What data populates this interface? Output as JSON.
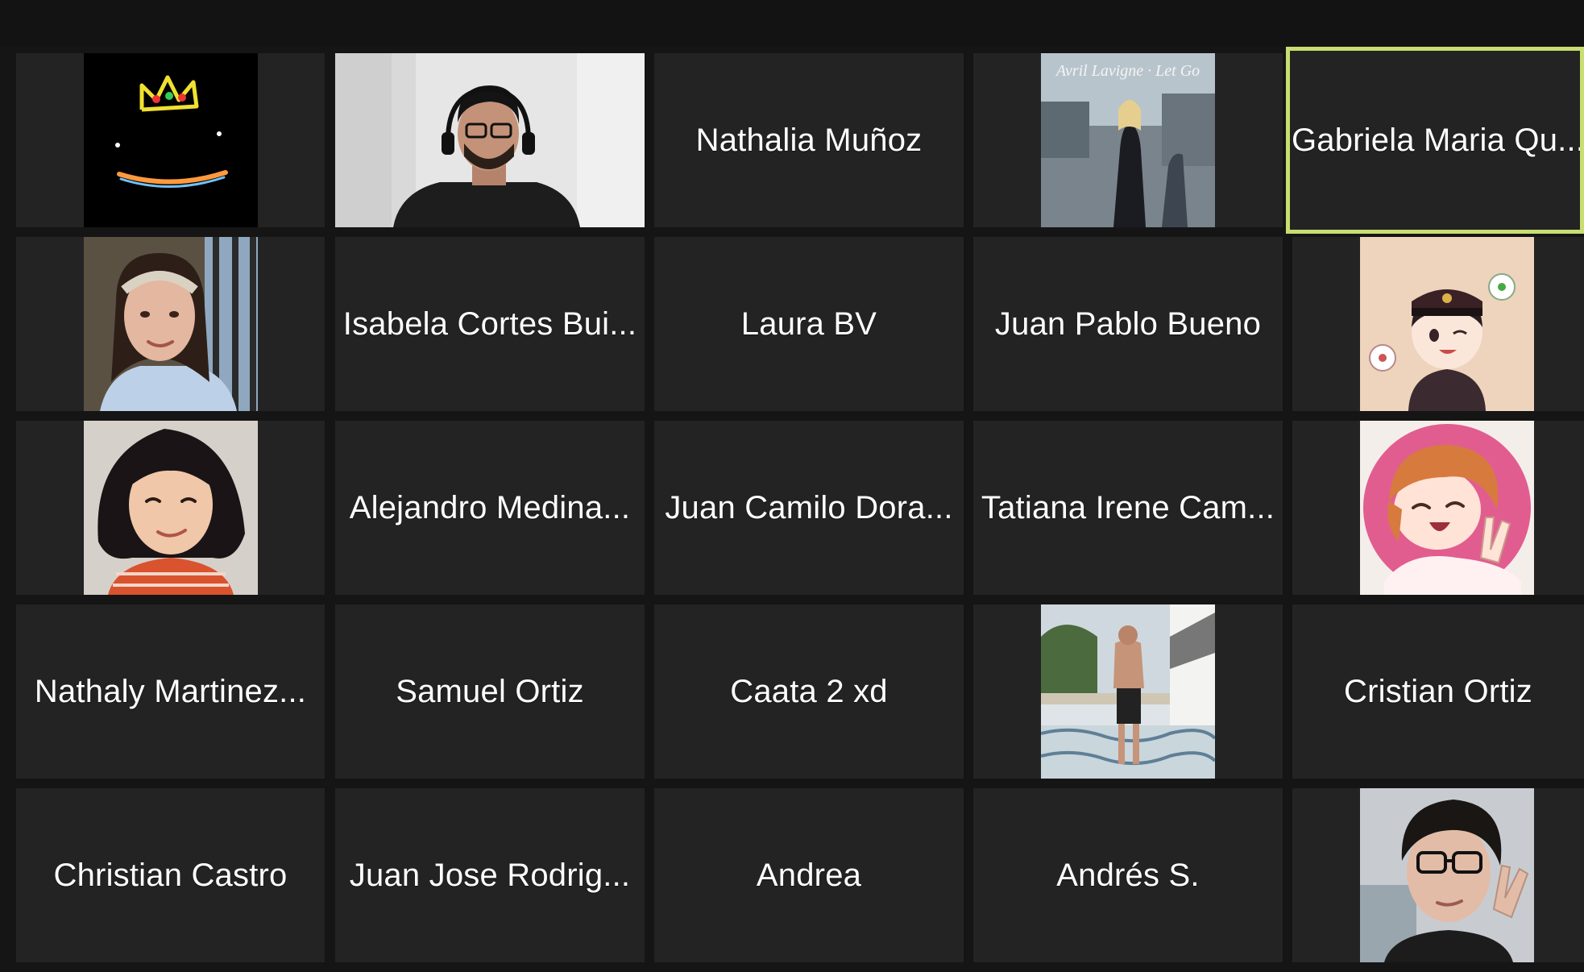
{
  "meeting": {
    "active_speaker_color": "#c8de72",
    "participants": [
      {
        "name": "",
        "avatar": "crown-smile-icon"
      },
      {
        "name": "",
        "video": "man-with-headset-video"
      },
      {
        "name": "Nathalia Muñoz"
      },
      {
        "name": "Avril Lavigne · Let Go",
        "avatar": "album-cover-avatar"
      },
      {
        "name": "Gabriela Maria Qu...",
        "active_speaker": true
      },
      {
        "name": "",
        "avatar": "woman-with-headband-photo"
      },
      {
        "name": "Isabela Cortes Bui..."
      },
      {
        "name": "Laura BV"
      },
      {
        "name": "Juan Pablo Bueno"
      },
      {
        "name": "",
        "avatar": "anime-boy-with-cap-avatar"
      },
      {
        "name": "",
        "avatar": "young-woman-photo"
      },
      {
        "name": "Alejandro Medina..."
      },
      {
        "name": "Juan Camilo Dora..."
      },
      {
        "name": "Tatiana Irene Cam..."
      },
      {
        "name": "",
        "avatar": "anime-girl-peace-sign-avatar"
      },
      {
        "name": "Nathaly Martinez..."
      },
      {
        "name": "Samuel Ortiz"
      },
      {
        "name": "Caata 2 xd"
      },
      {
        "name": "",
        "avatar": "shirtless-man-terrace-photo"
      },
      {
        "name": "Cristian Ortiz"
      },
      {
        "name": "Christian Castro"
      },
      {
        "name": "Juan Jose Rodrig..."
      },
      {
        "name": "Andrea"
      },
      {
        "name": "Andrés S."
      },
      {
        "name": "",
        "avatar": "boy-with-glasses-photo"
      }
    ]
  }
}
